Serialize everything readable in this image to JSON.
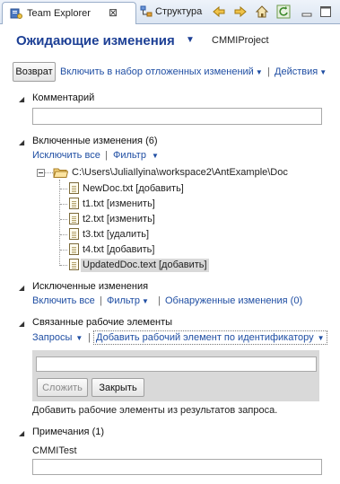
{
  "tabs": {
    "active_label": "Team Explorer",
    "close_glyph": "⊠",
    "second_label": "Структура"
  },
  "toolbar_icons": [
    "back-arrow-icon",
    "forward-arrow-icon",
    "home-icon",
    "refresh-icon",
    "minimize-icon",
    "maximize-icon"
  ],
  "header": {
    "title": "Ожидающие изменения",
    "dropdown_glyph": "▼",
    "project": "CMMIProject"
  },
  "actions": {
    "checkin": "Возврат",
    "shelve": "Включить в набор отложенных изменений",
    "actions": "Действия",
    "separator": "|"
  },
  "comment": {
    "title": "Комментарий",
    "value": ""
  },
  "included": {
    "title": "Включенные изменения (6)",
    "exclude_all": "Исключить все",
    "filter": "Фильтр",
    "folder_path": "C:\\Users\\JuliaIlyina\\workspace2\\AntExample\\Doc",
    "files": [
      {
        "name": "NewDoc.txt [добавить]"
      },
      {
        "name": "t1.txt [изменить]"
      },
      {
        "name": "t2.txt [изменить]"
      },
      {
        "name": "t3.txt [удалить]"
      },
      {
        "name": "t4.txt [добавить]"
      },
      {
        "name": "UpdatedDoc.text [добавить]"
      }
    ]
  },
  "excluded": {
    "title": "Исключенные изменения",
    "include_all": "Включить все",
    "filter": "Фильтр",
    "detected": "Обнаруженные изменения (0)"
  },
  "work_items": {
    "title": "Связанные рабочие элементы",
    "queries": "Запросы",
    "add_by_id": "Добавить рабочий элемент по идентификатору",
    "id_value": "",
    "add_button": "Сложить",
    "close_button": "Закрыть",
    "hint": "Добавить рабочие элементы из результатов запроса."
  },
  "notes": {
    "title": "Примечания (1)",
    "label": "CMMITest",
    "value": ""
  },
  "colors": {
    "accent": "#1c3f95",
    "link": "#1f4ea3",
    "selection": "#d9d9d9"
  }
}
